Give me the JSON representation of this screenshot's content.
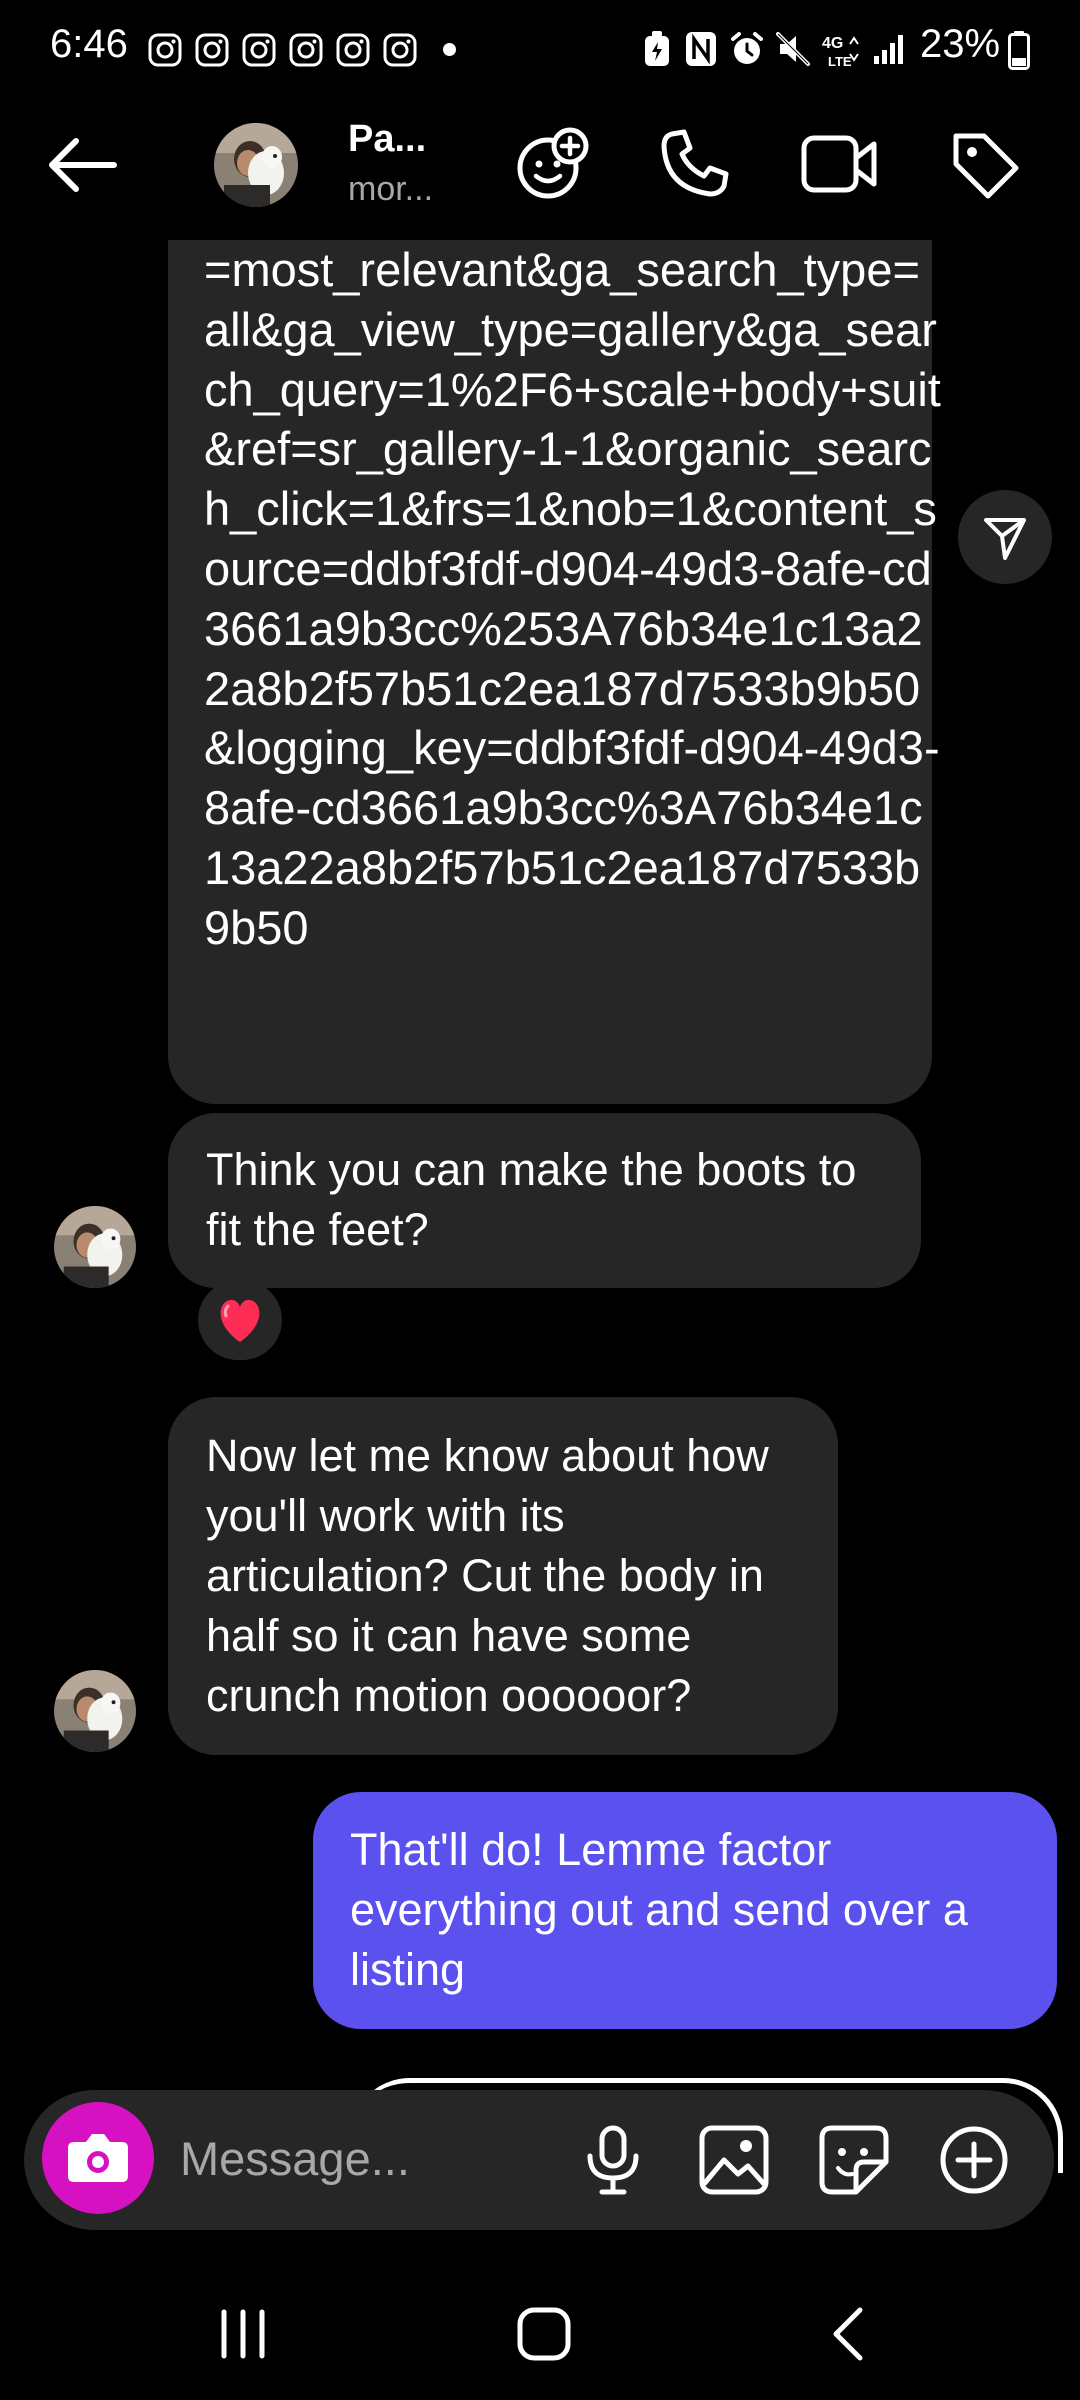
{
  "status_bar": {
    "time": "6:46",
    "battery_percent": "23%",
    "notification_icons": [
      "instagram-icon",
      "instagram-icon",
      "instagram-icon",
      "instagram-icon",
      "instagram-icon",
      "instagram-icon"
    ]
  },
  "header": {
    "name": "Pa...",
    "subtitle": "mor..."
  },
  "messages": [
    {
      "direction": "incoming",
      "text": "=most_relevant&ga_search_type=all&ga_view_type=gallery&ga_search_query=1%2F6+scale+body+suit&ref=sr_gallery-1-1&organic_search_click=1&frs=1&nob=1&content_source=ddbf3fdf-d904-49d3-8afe-cd3661a9b3cc%253A76b34e1c13a22a8b2f57b51c2ea187d7533b9b50&logging_key=ddbf3fdf-d904-49d3-8afe-cd3661a9b3cc%3A76b34e1c13a22a8b2f57b51c2ea187d7533b9b50"
    },
    {
      "direction": "incoming",
      "text": "Think you can make the boots to fit the feet?",
      "reaction": "❤️"
    },
    {
      "direction": "incoming",
      "text": "Now let me know about how you'll work with its articulation? Cut the body in half so it can have some crunch motion oooooor?"
    },
    {
      "direction": "outgoing",
      "text": "That'll do! Lemme factor everything out and send over a listing"
    }
  ],
  "composer": {
    "placeholder": "Message..."
  },
  "colors": {
    "background": "#000000",
    "incoming_bubble": "#262626",
    "outgoing_bubble": "#5b51ee",
    "camera_button": "#d511c2",
    "secondary_text": "#a8a8a8"
  }
}
